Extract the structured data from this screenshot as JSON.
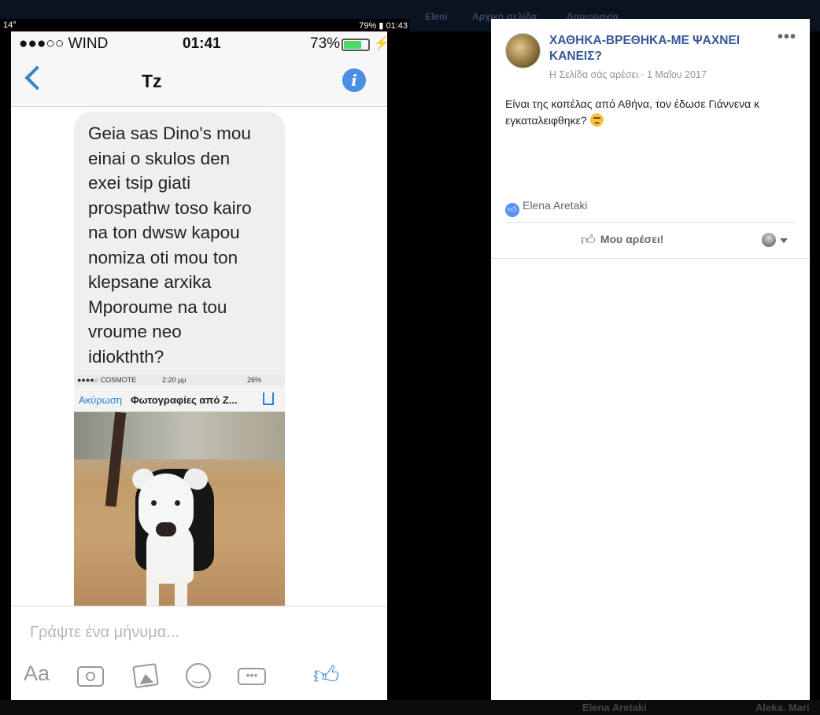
{
  "outer_status": {
    "left": "14°",
    "right": "79% ▮ 01:43"
  },
  "bg_nav": {
    "items": [
      "Eleni",
      "Αρχική σελίδα",
      "Δημιουργία"
    ]
  },
  "bg_bottom": {
    "items": [
      "Elena Aretaki",
      "Aleka. Mari"
    ]
  },
  "phone": {
    "status": {
      "carrier": "●●●○○ WIND",
      "time": "01:41",
      "battery_pct": "73%",
      "battery_level": 0.73
    },
    "header": {
      "title": "Tz"
    },
    "message": "Geia sas Dino's mou\neinai o skulos den\nexei tsip giati\nprospathw toso kairo\nna ton dwsw kapou\nnomiza oti mou ton\nklepsane arxika\nΜporoume na tou\nvroume  neo\nidiokthth?",
    "attachment": {
      "status_carrier": "●●●●○ COSMOTE",
      "status_time": "2:20 μμ",
      "status_battery": "26%",
      "cancel_label": "Ακύρωση",
      "title": "Φωτογραφίες από Ζ..."
    },
    "composer": {
      "placeholder": "Γράψτε ένα μήνυμα...",
      "aa_label": "Aa"
    }
  },
  "post": {
    "page_name": "ΧΑΘΗΚΑ-ΒΡΕΘΗΚΑ-ΜΕ ΨΑΧΝΕΙ ΚΑΝΕΙΣ?",
    "meta": "Η Σελίδα σάς αρέσει · 1 Μαΐου 2017",
    "menu": "•••",
    "body": "Είναι της κοπέλας από Αθήνα, τον έδωσε Γιάννενα κ εγκαταλειφθηκε?",
    "reaction_name": "Elena Aretaki",
    "like_label": "Μου αρέσει!"
  }
}
